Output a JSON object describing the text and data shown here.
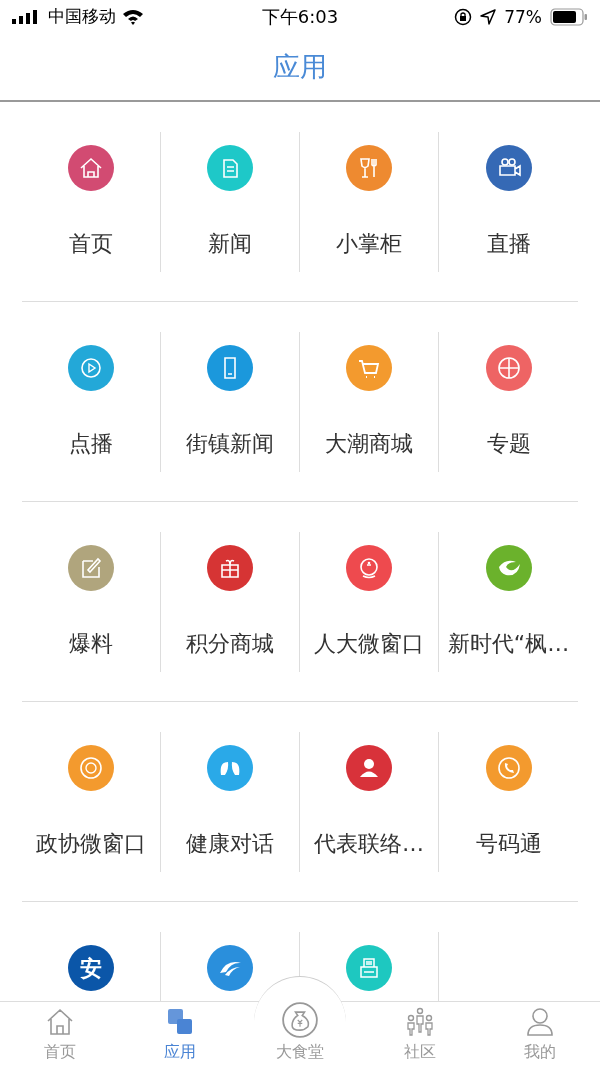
{
  "status_bar": {
    "carrier": "中国移动",
    "time": "下午6:03",
    "battery": "77%"
  },
  "header": {
    "title": "应用"
  },
  "apps": [
    {
      "label": "首页",
      "color": "#d24b72"
    },
    {
      "label": "新闻",
      "color": "#1ec8c8"
    },
    {
      "label": "小掌柜",
      "color": "#ee8a30"
    },
    {
      "label": "直播",
      "color": "#3569b5"
    },
    {
      "label": "点播",
      "color": "#23a8d8"
    },
    {
      "label": "街镇新闻",
      "color": "#1b98dc"
    },
    {
      "label": "大潮商城",
      "color": "#f39a2e"
    },
    {
      "label": "专题",
      "color": "#ee6464"
    },
    {
      "label": "爆料",
      "color": "#b0a57d"
    },
    {
      "label": "积分商城",
      "color": "#d63434"
    },
    {
      "label": "人大微窗口",
      "color": "#ee4a4e"
    },
    {
      "label": "新时代“枫…",
      "color": "#6bb22c"
    },
    {
      "label": "政协微窗口",
      "color": "#f39a2e"
    },
    {
      "label": "健康对话",
      "color": "#2aa9e8"
    },
    {
      "label": "代表联络…",
      "color": "#d8323a"
    },
    {
      "label": "号码通",
      "color": "#f39a2e"
    },
    {
      "glyph": "安",
      "color": "#0b56a8"
    },
    {
      "color": "#2a8fdc"
    },
    {
      "color": "#1ec8c0"
    }
  ],
  "tab_bar": [
    {
      "label": "首页",
      "selected": false
    },
    {
      "label": "应用",
      "selected": true
    },
    {
      "label": "大食堂",
      "selected": false
    },
    {
      "label": "社区",
      "selected": false
    },
    {
      "label": "我的",
      "selected": false
    }
  ]
}
